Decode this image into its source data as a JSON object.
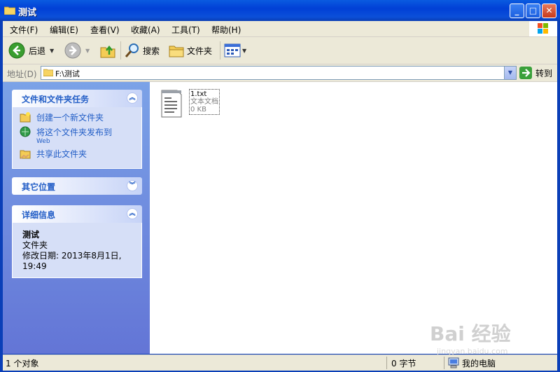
{
  "window": {
    "title": "测试"
  },
  "title_buttons": {
    "minimize": "_",
    "maximize": "□",
    "close": "✕"
  },
  "menu": [
    "文件(F)",
    "编辑(E)",
    "查看(V)",
    "收藏(A)",
    "工具(T)",
    "帮助(H)"
  ],
  "toolbar": {
    "back": "后退",
    "search": "搜索",
    "folders": "文件夹"
  },
  "address": {
    "label": "地址(D)",
    "path": "F:\\测试",
    "go": "转到"
  },
  "tasks_panel": {
    "title": "文件和文件夹任务",
    "items": [
      {
        "label": "创建一个新文件夹",
        "sub": ""
      },
      {
        "label": "将这个文件夹发布到",
        "sub": "Web"
      },
      {
        "label": "共享此文件夹",
        "sub": ""
      }
    ]
  },
  "other_panel": {
    "title": "其它位置"
  },
  "details_panel": {
    "title": "详细信息",
    "name": "测试",
    "type": "文件夹",
    "modified_line1": "修改日期: 2013年8月1日,",
    "modified_line2": "19:49"
  },
  "file": {
    "name": "1.txt",
    "type": "文本文档",
    "size": "0 KB"
  },
  "status": {
    "objects": "1 个对象",
    "bytes": "0 字节",
    "location": "我的电脑"
  },
  "watermark": {
    "text": "Bai 经验",
    "sub": "jingyan.baidu.com"
  },
  "colors": {
    "titlebar": "#0140d6",
    "panel_link": "#215dc6",
    "chrome": "#ece9d8"
  }
}
